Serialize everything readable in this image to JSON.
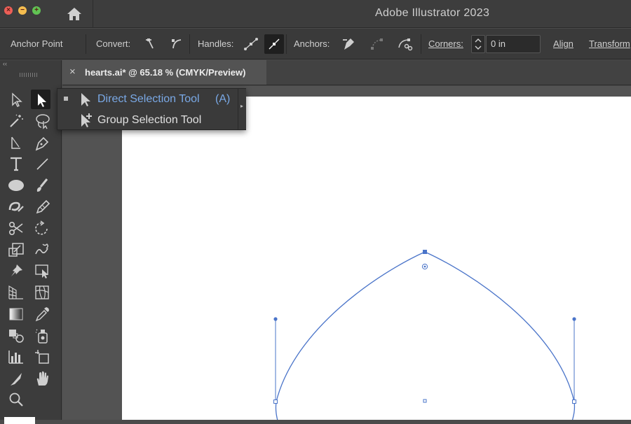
{
  "window": {
    "title": "Adobe Illustrator 2023",
    "controls": {
      "close": "×",
      "minimize": "−",
      "maximize": "+"
    }
  },
  "control_bar": {
    "context_label": "Anchor Point",
    "convert_label": "Convert:",
    "handles_label": "Handles:",
    "anchors_label": "Anchors:",
    "corners_label": "Corners:",
    "corners_value": "0 in",
    "align_label": "Align",
    "transform_label": "Transform"
  },
  "document_tab": {
    "close_glyph": "×",
    "title": "hearts.ai* @ 65.18 % (CMYK/Preview)"
  },
  "tool_panel": {
    "collapse_glyph": "‹‹",
    "tools": [
      "selection-tool",
      "direct-selection-tool",
      "magic-wand-tool",
      "lasso-tool",
      "anchor-point-tool",
      "pen-tool",
      "type-tool",
      "line-segment-tool",
      "ellipse-tool",
      "paintbrush-tool",
      "shaper-tool",
      "pencil-tool",
      "scissors-tool",
      "rotate-tool",
      "scale-tool",
      "warp-tool",
      "puppet-warp-tool",
      "free-transform-tool",
      "perspective-grid-tool",
      "mesh-tool",
      "gradient-tool",
      "eyedropper-tool",
      "blend-tool",
      "symbol-sprayer-tool",
      "graph-tool",
      "artboard-tool",
      "slice-tool",
      "hand-tool",
      "zoom-tool"
    ]
  },
  "flyout": {
    "items": [
      {
        "label": "Direct Selection Tool",
        "shortcut": "(A)",
        "icon": "direct-selection-icon",
        "selected": true
      },
      {
        "label": "Group Selection Tool",
        "shortcut": "",
        "icon": "group-selection-icon",
        "selected": false
      }
    ],
    "tearoff_glyph": "▸"
  },
  "colors": {
    "accent_blue": "#4a74c9",
    "flyout_active_text": "#7aa9e6",
    "ui_background": "#3c3c3c",
    "artboard": "#ffffff"
  }
}
